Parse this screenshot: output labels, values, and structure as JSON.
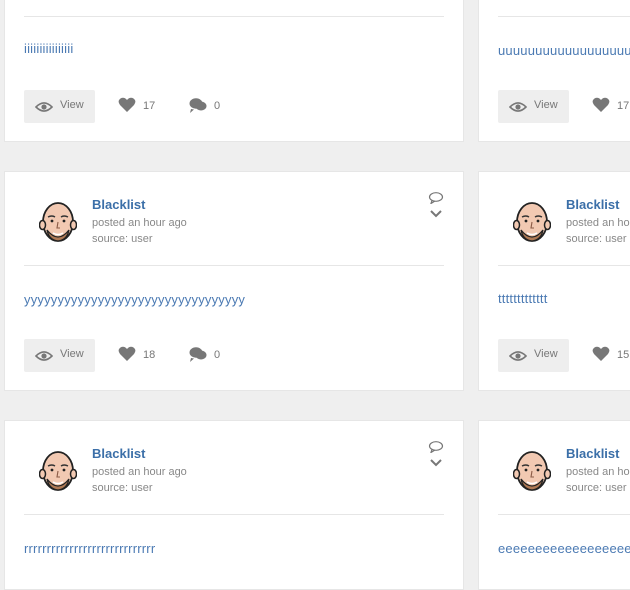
{
  "posts": [
    {
      "author": "",
      "time": "",
      "source": "",
      "text": "iiiiiiiiiiiiiiii",
      "view_label": "View",
      "likes": "17",
      "comments": "0"
    },
    {
      "author": "",
      "time": "",
      "source": "",
      "text": "uuuuuuuuuuuuuuuuuuuuuuuu",
      "view_label": "View",
      "likes": "17",
      "comments": ""
    },
    {
      "author": "Blacklist",
      "time": "posted an hour ago",
      "source": "source: user",
      "text": "yyyyyyyyyyyyyyyyyyyyyyyyyyyyyyyyy",
      "view_label": "View",
      "likes": "18",
      "comments": "0"
    },
    {
      "author": "Blacklist",
      "time": "posted an hour ago",
      "source": "source: user",
      "text": "ttttttttttttt",
      "view_label": "View",
      "likes": "15",
      "comments": ""
    },
    {
      "author": "Blacklist",
      "time": "posted an hour ago",
      "source": "source: user",
      "text": "rrrrrrrrrrrrrrrrrrrrrrrrrrrrr",
      "view_label": "",
      "likes": "",
      "comments": ""
    },
    {
      "author": "Blacklist",
      "time": "posted an hour ago",
      "source": "source: user",
      "text": "eeeeeeeeeeeeeeeeeeeee",
      "view_label": "",
      "likes": "",
      "comments": ""
    }
  ],
  "icons": {
    "view": "eye-icon",
    "likes": "heart-icon",
    "comments": "comment-icon",
    "post_menu": "speech-bubble-icon",
    "expand": "chevron-down-icon",
    "avatar": "bald-man-avatar"
  },
  "colors": {
    "link": "#3b6fa8",
    "body_text": "#4b7ab3",
    "muted": "#888888",
    "page_bg": "#efefef",
    "button_bg": "#eeeeee"
  }
}
